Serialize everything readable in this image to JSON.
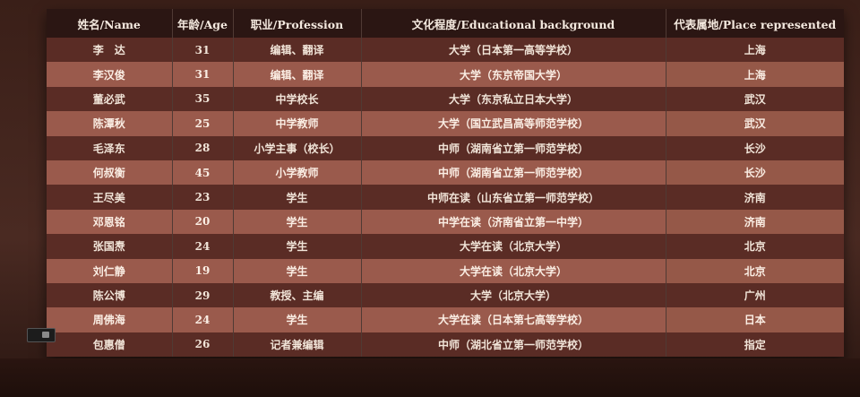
{
  "table": {
    "headers": [
      "姓名/Name",
      "年龄/Age",
      "职业/Profession",
      "文化程度/Educational background",
      "代表属地/Place represented"
    ],
    "rows": [
      [
        "李　达",
        "31",
        "编辑、翻译",
        "大学（日本第一高等学校）",
        "上海"
      ],
      [
        "李汉俊",
        "31",
        "编辑、翻译",
        "大学（东京帝国大学）",
        "上海"
      ],
      [
        "董必武",
        "35",
        "中学校长",
        "大学（东京私立日本大学）",
        "武汉"
      ],
      [
        "陈潭秋",
        "25",
        "中学教师",
        "大学（国立武昌高等师范学校）",
        "武汉"
      ],
      [
        "毛泽东",
        "28",
        "小学主事（校长）",
        "中师（湖南省立第一师范学校）",
        "长沙"
      ],
      [
        "何叔衡",
        "45",
        "小学教师",
        "中师（湖南省立第一师范学校）",
        "长沙"
      ],
      [
        "王尽美",
        "23",
        "学生",
        "中师在读（山东省立第一师范学校）",
        "济南"
      ],
      [
        "邓恩铭",
        "20",
        "学生",
        "中学在读（济南省立第一中学）",
        "济南"
      ],
      [
        "张国焘",
        "24",
        "学生",
        "大学在读（北京大学）",
        "北京"
      ],
      [
        "刘仁静",
        "19",
        "学生",
        "大学在读（北京大学）",
        "北京"
      ],
      [
        "陈公博",
        "29",
        "教授、主编",
        "大学（北京大学）",
        "广州"
      ],
      [
        "周佛海",
        "24",
        "学生",
        "大学在读（日本第七高等学校）",
        "日本"
      ],
      [
        "包惠僧",
        "26",
        "记者兼编辑",
        "中师（湖北省立第一师范学校）",
        "指定"
      ]
    ]
  },
  "colors": {
    "header_bg": "#2b1613",
    "row_dark": "#5a2c25",
    "row_light": "#9a5a4c",
    "text": "#f1e4d8"
  }
}
